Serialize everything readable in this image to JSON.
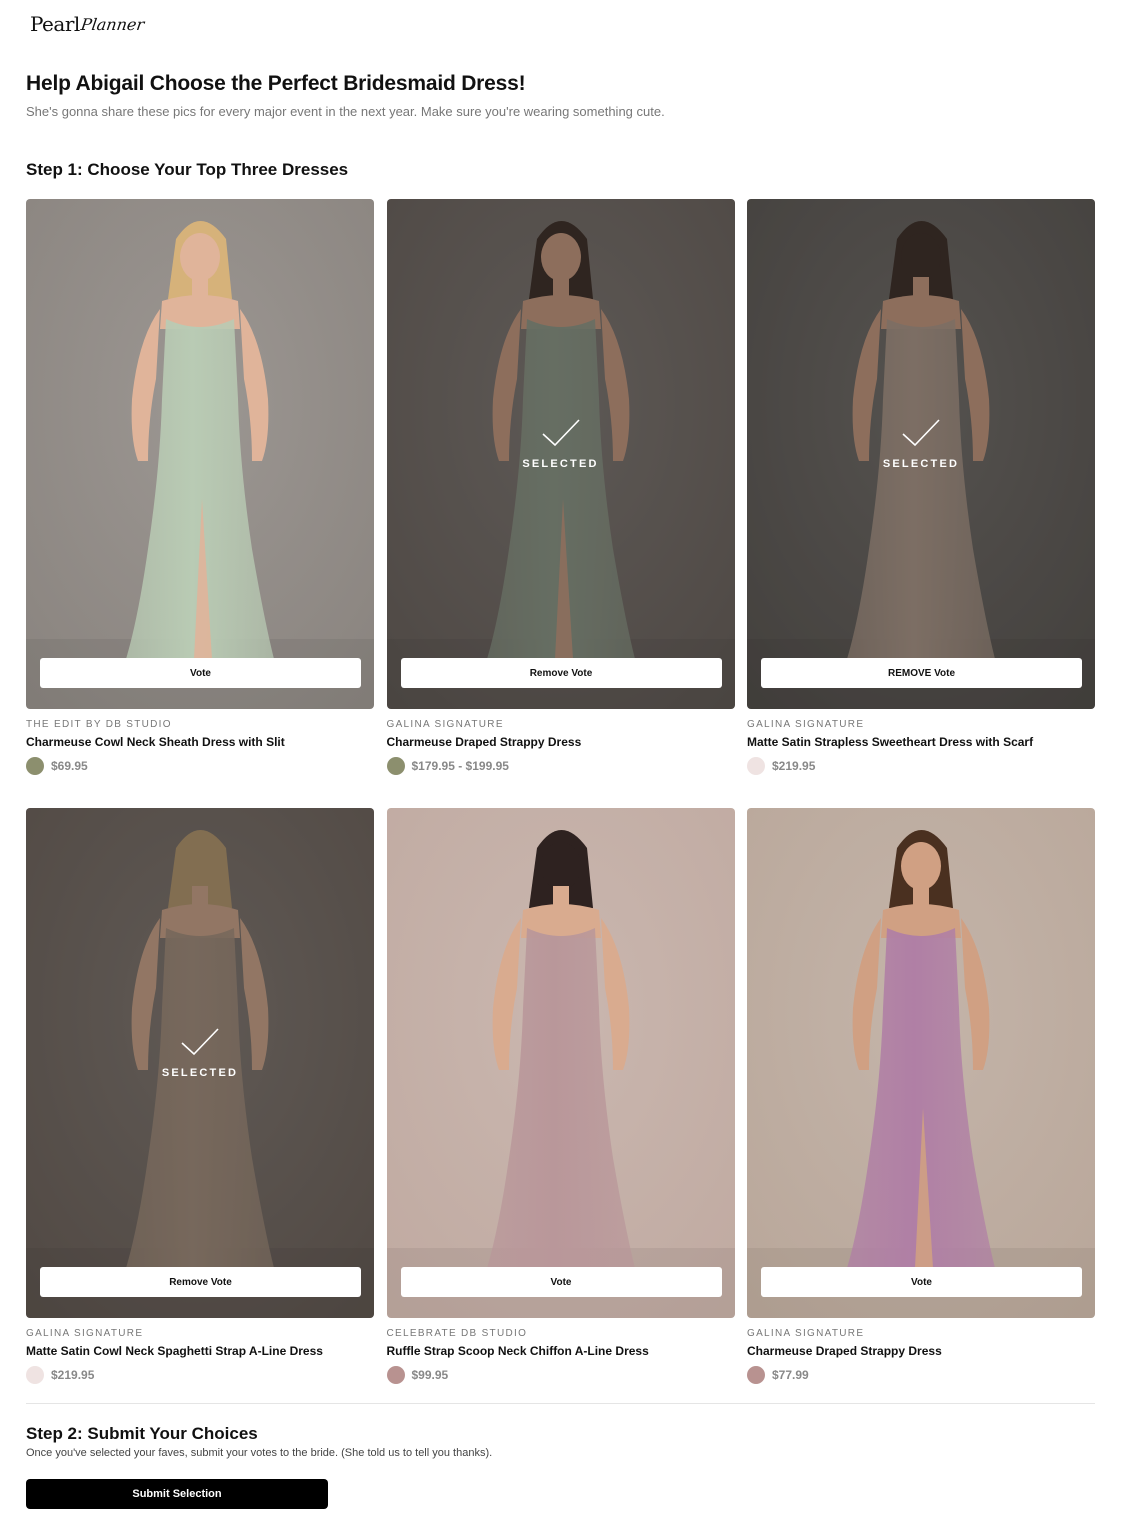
{
  "logo": {
    "part1": "Pearl",
    "part2": "Planner"
  },
  "hero": {
    "title": "Help Abigail Choose the Perfect Bridesmaid Dress!",
    "subtitle": "She's gonna share these pics for every major event in the next year. Make sure you're wearing something cute."
  },
  "step1": {
    "title": "Step 1: Choose Your Top Three Dresses"
  },
  "selected_label": "SELECTED",
  "dresses": [
    {
      "brand": "THE EDIT BY DB STUDIO",
      "name": "Charmeuse Cowl Neck Sheath Dress with Slit",
      "price": "$69.95",
      "swatch": "#8c8f6e",
      "button": "Vote",
      "selected": false,
      "bg": "#8a847f",
      "dress": "#b9cbb4",
      "skin": "#e0b49a",
      "hair": "#d6b27a",
      "pose": "front"
    },
    {
      "brand": "GALINA SIGNATURE",
      "name": "Charmeuse Draped Strappy Dress",
      "price": "$179.95 - $199.95",
      "swatch": "#8c8f6e",
      "button": "Remove Vote",
      "selected": true,
      "bg": "#6a615b",
      "dress": "#8e9a88",
      "skin": "#c99a7f",
      "hair": "#3a2a22",
      "pose": "front"
    },
    {
      "brand": "GALINA SIGNATURE",
      "name": "Matte Satin Strapless Sweetheart Dress with Scarf",
      "price": "$219.95",
      "swatch": "#efe3e2",
      "button": "REMOVE Vote",
      "selected": true,
      "bg": "#5a5550",
      "dress": "#b09a8a",
      "skin": "#c99a7f",
      "hair": "#3a2a22",
      "pose": "back"
    },
    {
      "brand": "GALINA SIGNATURE",
      "name": "Matte Satin Cowl Neck Spaghetti Strap A-Line Dress",
      "price": "$219.95",
      "swatch": "#efe3e2",
      "button": "Remove Vote",
      "selected": true,
      "bg": "#6e625a",
      "dress": "#a8917e",
      "skin": "#d2a78a",
      "hair": "#b89a6e",
      "pose": "back"
    },
    {
      "brand": "CELEBRATE DB STUDIO",
      "name": "Ruffle Strap Scoop Neck Chiffon A-Line Dress",
      "price": "$99.95",
      "swatch": "#b89290",
      "button": "Vote",
      "selected": false,
      "bg": "#c0aaa1",
      "dress": "#b9979a",
      "skin": "#d9ab8f",
      "hair": "#2e2220",
      "pose": "back"
    },
    {
      "brand": "GALINA SIGNATURE",
      "name": "Charmeuse Draped Strappy Dress",
      "price": "$77.99",
      "swatch": "#b89290",
      "button": "Vote",
      "selected": false,
      "bg": "#b9a79a",
      "dress": "#b07fa5",
      "skin": "#d0a083",
      "hair": "#4a3020",
      "pose": "front"
    }
  ],
  "step2": {
    "title": "Step 2: Submit Your Choices",
    "subtitle": "Once you've selected your faves, submit your votes to the bride. (She told us to tell you thanks).",
    "submit_label": "Submit Selection"
  }
}
